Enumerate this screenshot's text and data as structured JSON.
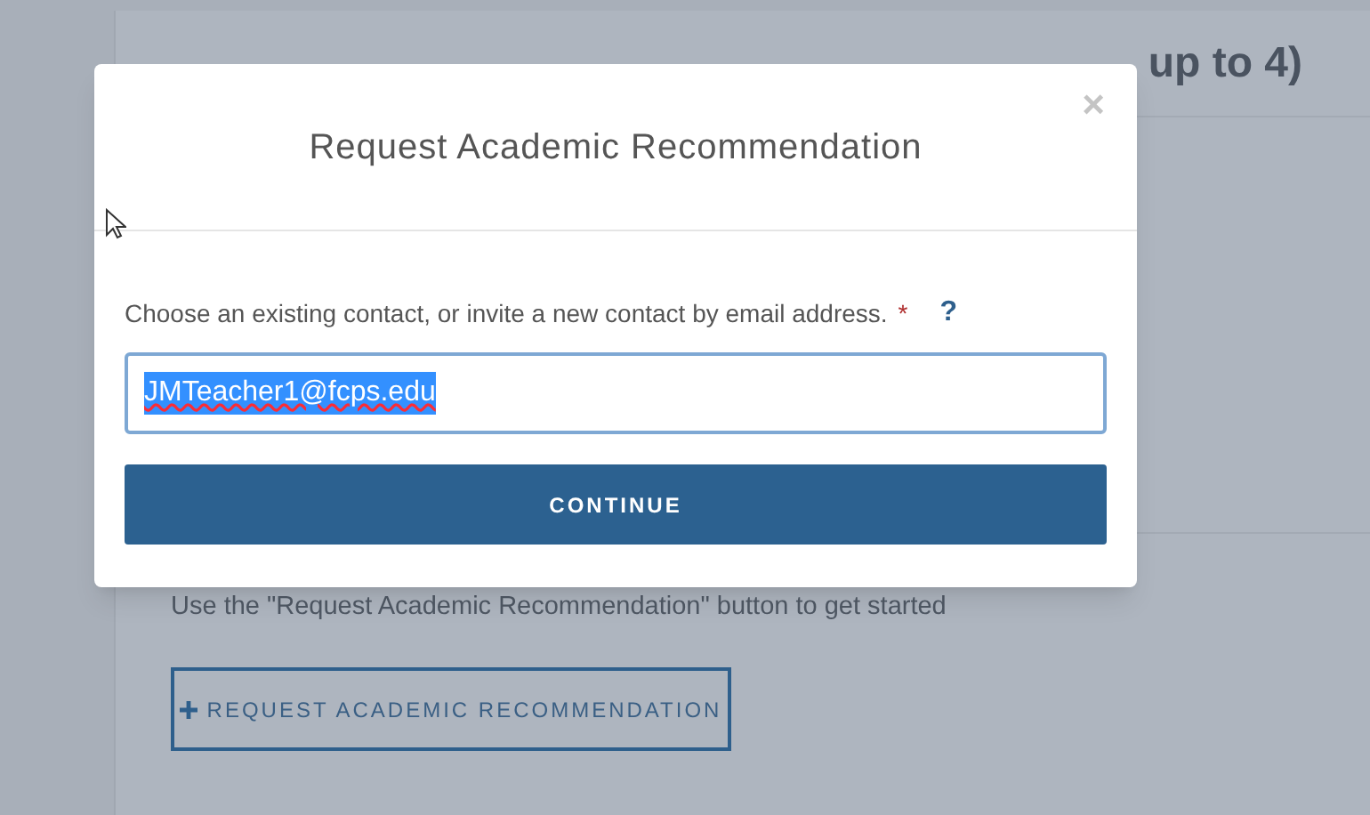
{
  "background": {
    "heading": "up to 4)",
    "hint": "Use the \"Request Academic Recommendation\" button to get started",
    "request_button": "REQUEST ACADEMIC RECOMMENDATION"
  },
  "dialog": {
    "title": "Request Academic Recommendation",
    "close": "×",
    "field_label": "Choose an existing contact, or invite a new contact by email address.",
    "required_mark": "*",
    "help": "?",
    "value": "JMTeacher1@fcps.edu",
    "value_selected": true,
    "button": "CONTINUE"
  }
}
